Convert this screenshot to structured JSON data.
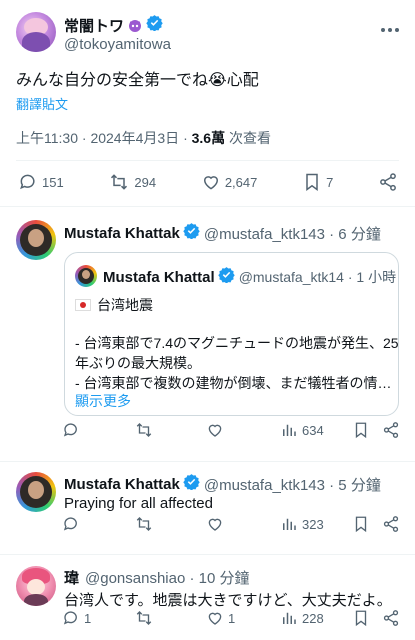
{
  "main_post": {
    "display_name": "常闇トワ",
    "handle": "@tokoyamitowa",
    "text": "みんな自分の安全第一でね😭心配",
    "translate_label": "翻譯貼文",
    "time": "上午11:30",
    "sep1": "·",
    "date": "2024年4月3日",
    "sep2": "·",
    "views": "3.6萬",
    "views_label": "次查看",
    "replies": "151",
    "reposts": "294",
    "likes": "2,647",
    "bookmarks": "7"
  },
  "reply1": {
    "display_name": "Mustafa Khattak",
    "handle": "@mustafa_ktk143 · 6 分鐘",
    "quote": {
      "display_name": "Mustafa Khattal",
      "handle": "@mustafa_ktk14 · 1 小時",
      "line1": "台湾地震",
      "line2": "- 台湾東部で7.4のマグニチュードの地震が発生、25",
      "line3": "年ぶりの最大規模。",
      "line4": "- 台湾東部で複数の建物が倒壊、まだ犠牲者の情…",
      "show_more": "顯示更多"
    },
    "views": "634"
  },
  "reply2": {
    "display_name": "Mustafa Khattak",
    "handle": "@mustafa_ktk143 · 5 分鐘",
    "text": "Praying for all affected",
    "views": "323"
  },
  "reply3": {
    "display_name": "瑋",
    "handle": "@gonsanshiao · 10 分鐘",
    "text": "台湾人です。地震は大きですけど、大丈夫だよ。",
    "replies": "1",
    "likes": "1",
    "views": "228"
  },
  "colors": {
    "accent": "#1d9bf0",
    "text": "#0f1419",
    "muted": "#536471"
  }
}
